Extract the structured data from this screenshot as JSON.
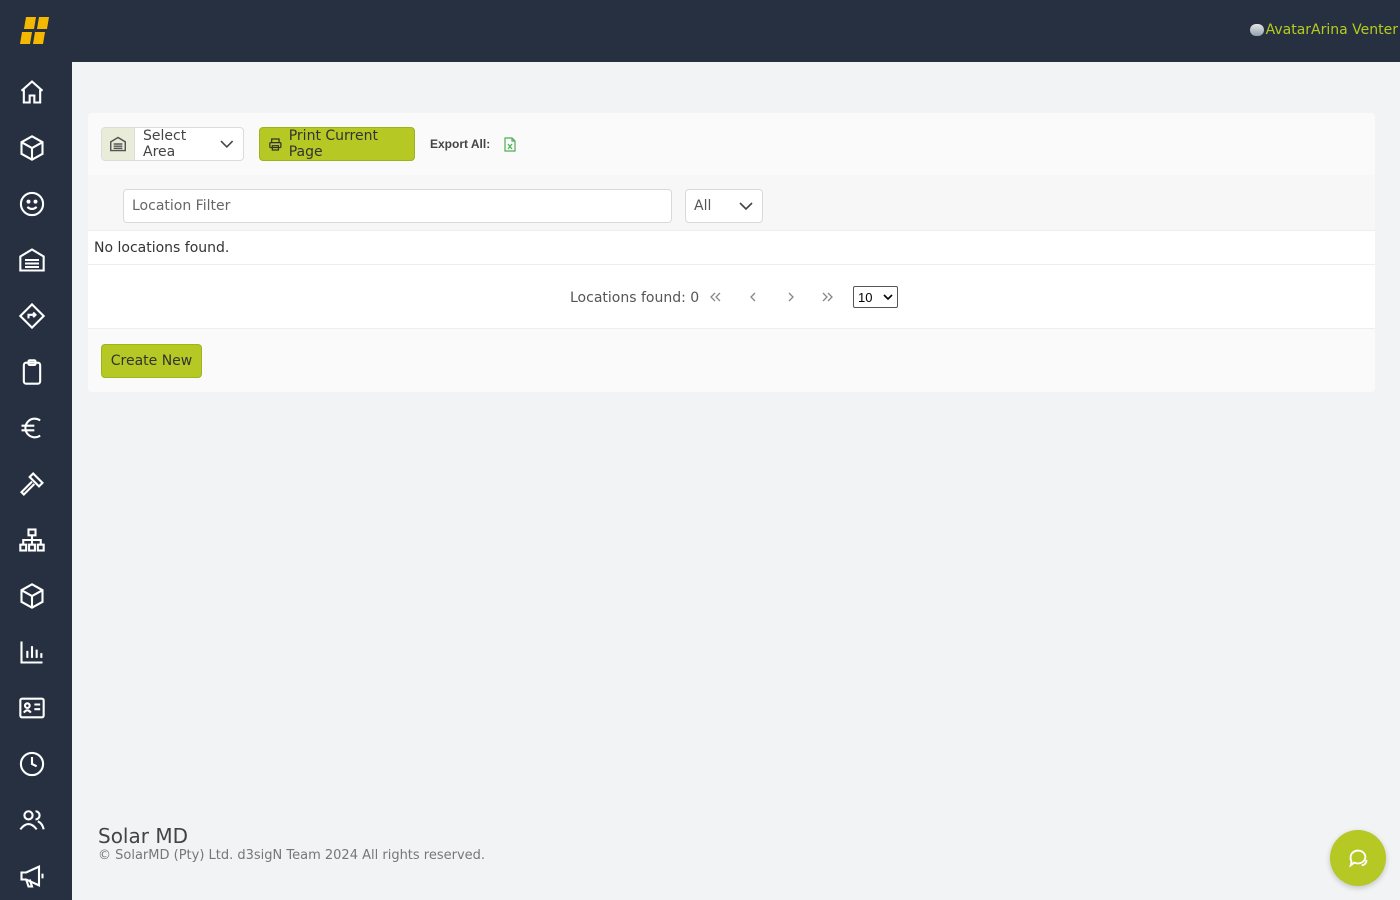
{
  "header": {
    "logo_icon": "solar-md-logo-icon",
    "user_avatar_alt": "Avatar",
    "user_name": "Arina Venter"
  },
  "sidebar": {
    "items": [
      {
        "icon": "home-icon"
      },
      {
        "icon": "box-icon"
      },
      {
        "icon": "smiley-icon"
      },
      {
        "icon": "warehouse-icon"
      },
      {
        "icon": "route-icon"
      },
      {
        "icon": "clipboard-icon"
      },
      {
        "icon": "euro-icon"
      },
      {
        "icon": "hammer-icon"
      },
      {
        "icon": "hierarchy-icon"
      },
      {
        "icon": "cube-icon"
      },
      {
        "icon": "chart-icon"
      },
      {
        "icon": "id-card-icon"
      },
      {
        "icon": "clock-icon"
      },
      {
        "icon": "users-icon"
      },
      {
        "icon": "megaphone-icon"
      }
    ]
  },
  "toolbar": {
    "area_select": "Select Area",
    "print_label": "Print Current Page",
    "export_label": "Export All:"
  },
  "filters": {
    "location_placeholder": "Location Filter",
    "location_value": "",
    "status_value": "All"
  },
  "table": {
    "empty_message": "No locations found."
  },
  "pagination": {
    "found_text": "Locations found: 0",
    "page_size": "10"
  },
  "actions": {
    "create_label": "Create New"
  },
  "footer": {
    "title": "Solar MD",
    "copyright": "© SolarMD (Pty) Ltd. d3sigN Team 2024 All rights reserved."
  },
  "colors": {
    "sidebar_bg": "#263040",
    "accent": "#b5c823",
    "user_name": "#b5cc1e",
    "logo": "#f5b800"
  }
}
